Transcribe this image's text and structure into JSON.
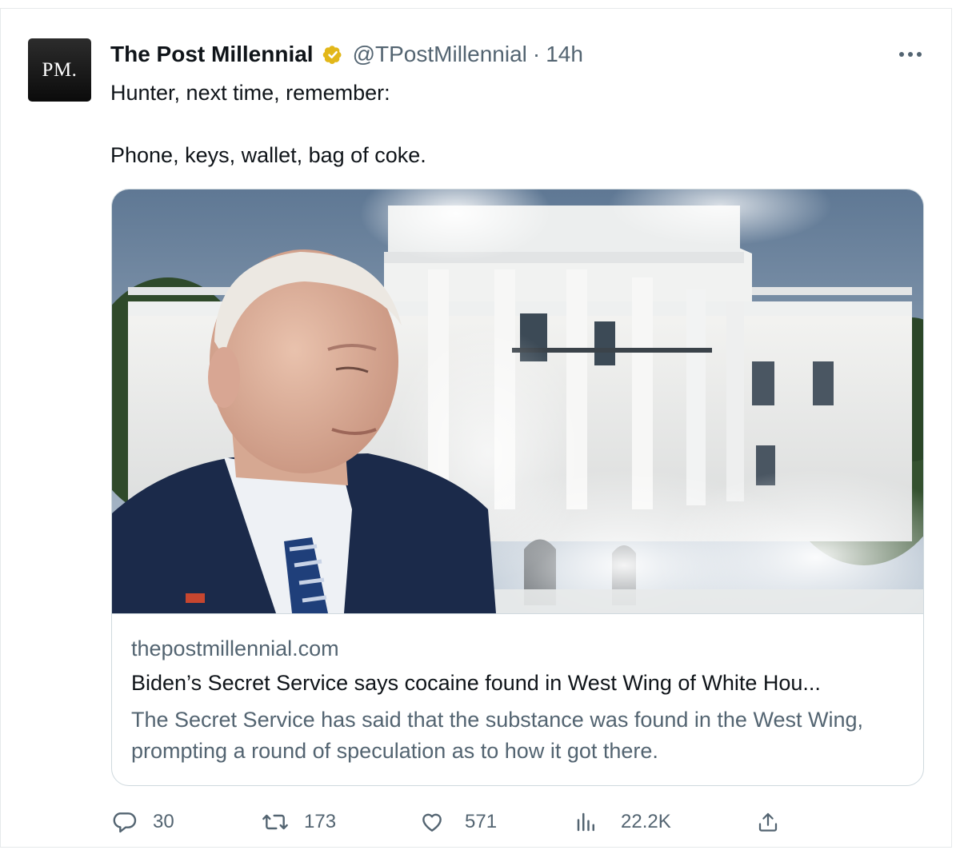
{
  "tweet": {
    "avatar_text": "PM.",
    "display_name": "The Post Millennial",
    "handle": "@TPostMillennial",
    "separator": "·",
    "time": "14h",
    "text_line1": "Hunter, next time, remember:",
    "text_line2": "Phone, keys, wallet, bag of coke."
  },
  "card": {
    "domain": "thepostmillennial.com",
    "title": "Biden’s Secret Service says cocaine found in West Wing of White Hou...",
    "description": "The Secret Service has said that the substance was found in the West Wing, prompting a round of speculation as to how it got there."
  },
  "actions": {
    "replies": "30",
    "reposts": "173",
    "likes": "571",
    "views": "22.2K"
  },
  "colors": {
    "text_primary": "#0f1419",
    "text_secondary": "#536471",
    "border": "#cfd9de",
    "verified_gold": "#e2b719"
  },
  "icons": {
    "verified": "verified-badge-icon",
    "more": "more-icon",
    "reply": "reply-icon",
    "repost": "repost-icon",
    "like": "like-icon",
    "views": "views-icon",
    "share": "share-icon"
  }
}
